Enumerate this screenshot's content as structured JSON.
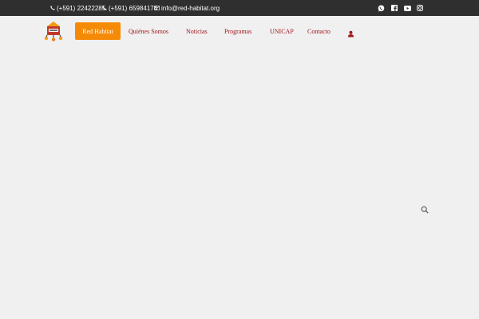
{
  "topbar": {
    "phone_1": "(+591) 22422285",
    "phone_2": "(+591) 65984174",
    "email": "info@red-habitat.org",
    "phone_icon": "phone-icon",
    "email_icon": "envelope-icon",
    "social_icons": [
      "whatsapp-icon",
      "facebook-icon",
      "youtube-icon",
      "instagram-icon"
    ]
  },
  "nav": {
    "items": [
      "Red Habitat",
      "Quiénes Somos",
      "Noticias",
      "Programas",
      "UNICAP",
      "Contacto"
    ],
    "active_index": 0,
    "user_icon": "user-icon"
  },
  "search": {
    "icon": "search-icon"
  },
  "colors": {
    "topbar_bg": "#2f2f2f",
    "page_bg": "#f0f0f0",
    "accent_orange": "#f58a07",
    "nav_text": "#a0141a"
  }
}
